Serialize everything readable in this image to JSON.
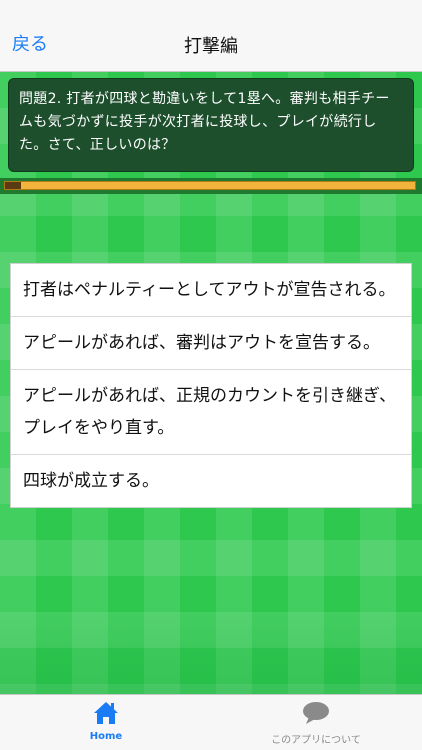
{
  "nav": {
    "back_label": "戻る",
    "title": "打撃編"
  },
  "question": {
    "text": "問題2. 打者が四球と勘違いをして1塁へ。審判も相手チームも気づかずに投手が次打者に投球し、プレイが続行した。さて、正しいのは？"
  },
  "progress": {
    "fraction": 0.04
  },
  "answers": [
    {
      "label": "打者はペナルティーとしてアウトが宣告される。"
    },
    {
      "label": "アピールがあれば、審判はアウトを宣告する。"
    },
    {
      "label": "アピールがあれば、正規のカウントを引き継ぎ、プレイをやり直す。"
    },
    {
      "label": "四球が成立する。"
    }
  ],
  "tabbar": {
    "home_label": "Home",
    "about_label": "このアプリについて",
    "home_icon": "home-icon",
    "about_icon": "speech-bubble-icon",
    "active_color": "#1a7cf5",
    "inactive_color": "#8a8a8a"
  }
}
